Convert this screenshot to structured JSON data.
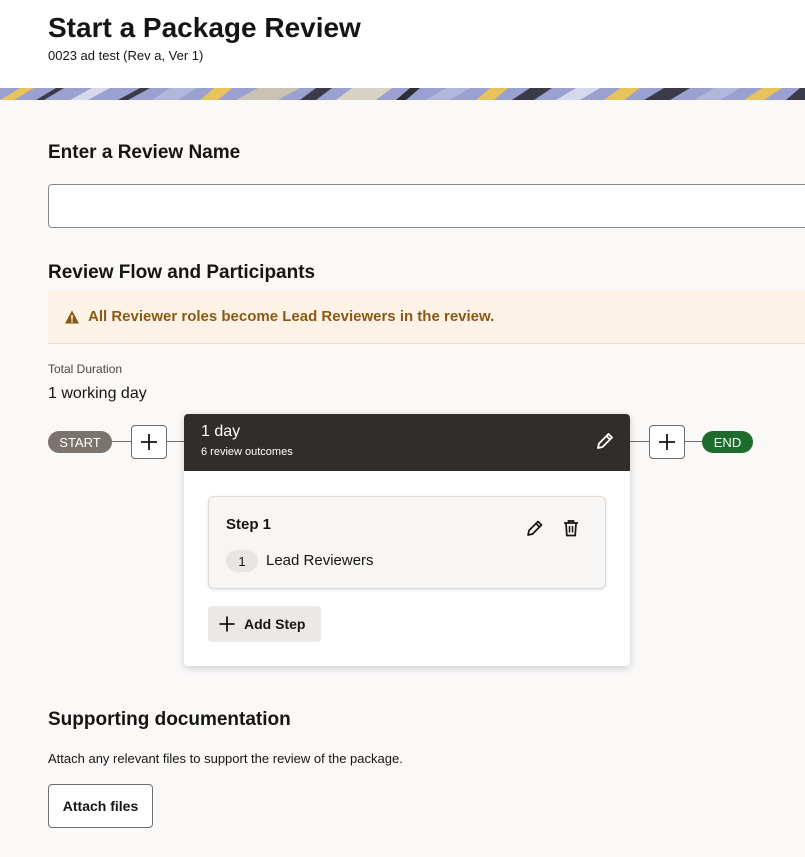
{
  "header": {
    "title": "Start a Package Review",
    "subtitle": "0023 ad test (Rev a, Ver 1)"
  },
  "review_name": {
    "heading": "Enter a Review Name",
    "value": "",
    "placeholder": ""
  },
  "flow": {
    "heading": "Review Flow and Participants",
    "warning_text": "All Reviewer roles become Lead Reviewers in the review.",
    "total_duration_label": "Total Duration",
    "total_duration_value": "1 working day",
    "start_label": "START",
    "end_label": "END",
    "stage": {
      "duration": "1 day",
      "outcomes": "6 review outcomes",
      "steps": [
        {
          "title": "Step 1",
          "count": "1",
          "role": "Lead Reviewers"
        }
      ],
      "add_step_label": "Add Step"
    }
  },
  "docs": {
    "heading": "Supporting documentation",
    "description": "Attach any relevant files to support the review of the package.",
    "attach_label": "Attach files"
  },
  "colors": {
    "warning_icon": "#8a5a14",
    "start_pill": "#7a736e",
    "end_pill": "#1e6b2e",
    "stage_header": "#312d2a"
  }
}
